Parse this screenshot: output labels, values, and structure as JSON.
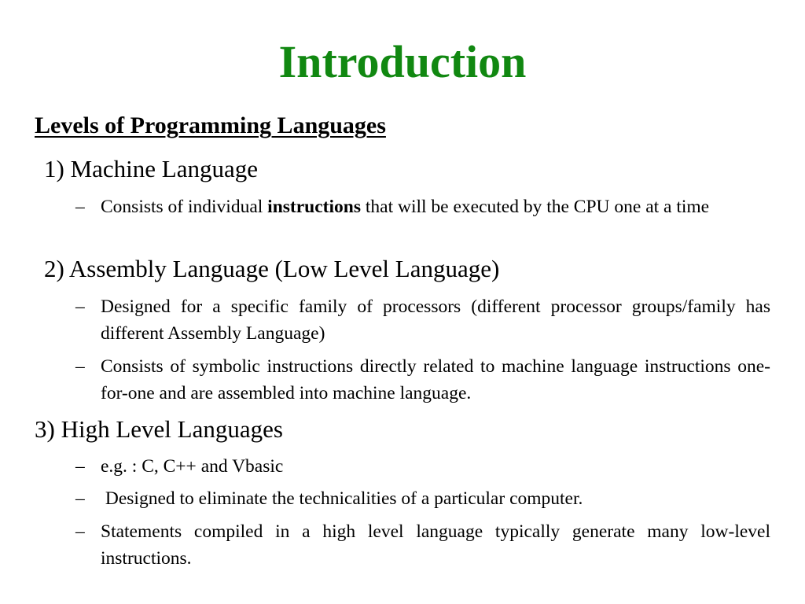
{
  "slide": {
    "title": "Introduction",
    "heading": "Levels of Programming Languages",
    "title_color": "#118811",
    "levels": [
      {
        "label": "1) Machine Language",
        "bullets": [
          {
            "dash": "–",
            "parts": [
              "Consists of individual ",
              "instructions",
              " that will be executed by the CPU one at a time"
            ]
          }
        ]
      },
      {
        "label": "2) Assembly Language (Low Level Language)",
        "bullets": [
          {
            "dash": "–",
            "text": "Designed for a specific family of processors (different processor groups/family has different Assembly Language)"
          },
          {
            "dash": "–",
            "text": "Consists of symbolic instructions directly related to machine language instructions one-for-one and are assembled into machine language."
          }
        ]
      },
      {
        "label": "3) High Level Languages",
        "bullets": [
          {
            "dash": "–",
            "text": "e.g. : C, C++ and Vbasic"
          },
          {
            "dash": "–",
            "text": " Designed to eliminate the technicalities of a particular computer."
          },
          {
            "dash": "–",
            "text": "Statements compiled in a high level language typically generate many low-level instructions."
          }
        ]
      }
    ]
  }
}
